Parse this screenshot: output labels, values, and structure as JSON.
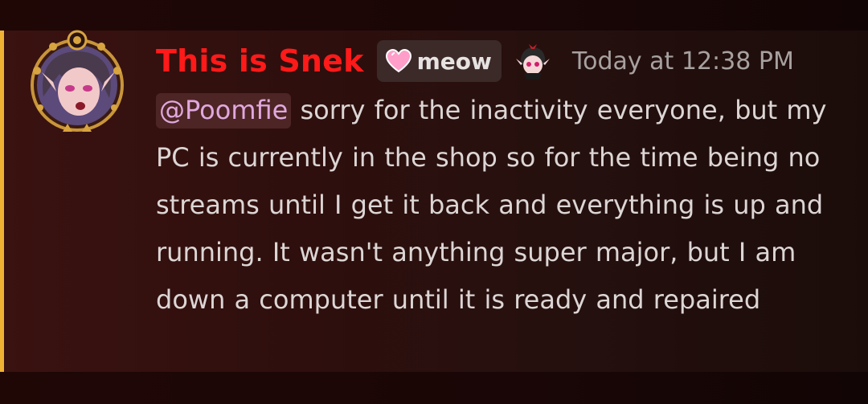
{
  "message": {
    "author": "This is Snek",
    "author_color": "#ff1a1a",
    "role_tag": {
      "icon": "pink-heart-icon",
      "label": "meow"
    },
    "server_icon": "chibi-avatar-icon",
    "timestamp": "Today at 12:38 PM",
    "mention": "@Poomfie",
    "text": " sorry for the inactivity everyone, but my PC is currently in the shop so for the time being no streams until I get it back and everything is up and running. It wasn't anything super major, but I am down a computer until it is ready and repaired",
    "mention_highlight_color": "#f0b232"
  }
}
